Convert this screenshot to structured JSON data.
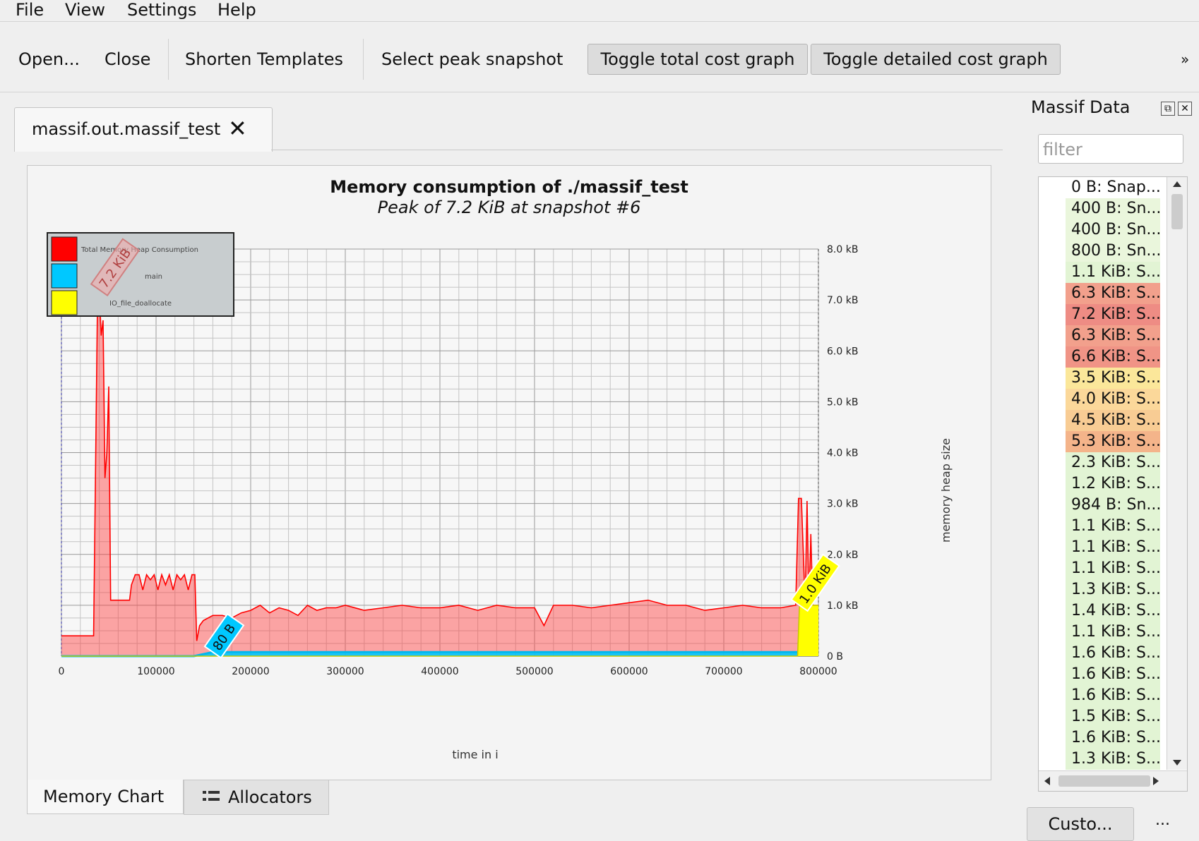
{
  "menu": {
    "file": "File",
    "view": "View",
    "settings": "Settings",
    "help": "Help"
  },
  "toolbar": {
    "open": "Open...",
    "close": "Close",
    "shorten": "Shorten Templates",
    "select_peak": "Select peak snapshot",
    "toggle_total": "Toggle total cost graph",
    "toggle_detailed": "Toggle detailed cost graph",
    "overflow": "»"
  },
  "tab": {
    "label": "massif.out.massif_test",
    "close": "✕"
  },
  "chart_data": {
    "type": "area",
    "title": "Memory consumption of ./massif_test",
    "subtitle": "Peak of 7.2 KiB at snapshot #6",
    "xlabel": "time in i",
    "ylabel": "memory heap size",
    "xlim": [
      0,
      800000
    ],
    "ylim": [
      0,
      8.0
    ],
    "x_ticks": [
      "0",
      "100000",
      "200000",
      "300000",
      "400000",
      "500000",
      "600000",
      "700000",
      "800000"
    ],
    "y_ticks": [
      "0 B",
      "1.0 kB",
      "2.0 kB",
      "3.0 kB",
      "4.0 kB",
      "5.0 kB",
      "6.0 kB",
      "7.0 kB",
      "8.0 kB"
    ],
    "grid": true,
    "legend_position": "top-left",
    "legend": [
      "Total Memory Heap Consumption",
      "main",
      "IO_file_doallocate"
    ],
    "colors": {
      "total": "#ff0000",
      "main": "#00c8ff",
      "io": "#ffff00"
    },
    "annotations": [
      {
        "text": "7.2 KiB",
        "x": 40000,
        "y": 7.2
      },
      {
        "text": "80 B",
        "x": 160000,
        "y": 0.08
      },
      {
        "text": "1.0 KiB",
        "x": 780000,
        "y": 1.0
      }
    ],
    "series": [
      {
        "name": "Total Memory Heap Consumption",
        "x": [
          0,
          30000,
          34000,
          38000,
          40000,
          42000,
          44000,
          46000,
          48000,
          50000,
          52000,
          56000,
          60000,
          72000,
          74000,
          78000,
          82000,
          86000,
          90000,
          94000,
          98000,
          102000,
          106000,
          110000,
          114000,
          118000,
          122000,
          126000,
          130000,
          134000,
          138000,
          141000,
          143000,
          146000,
          150000,
          160000,
          170000,
          180000,
          190000,
          200000,
          210000,
          220000,
          230000,
          240000,
          250000,
          260000,
          270000,
          280000,
          290000,
          300000,
          320000,
          340000,
          360000,
          380000,
          400000,
          420000,
          440000,
          460000,
          480000,
          500000,
          510000,
          520000,
          540000,
          560000,
          580000,
          600000,
          620000,
          640000,
          660000,
          680000,
          700000,
          720000,
          740000,
          760000,
          776000,
          779000,
          782000,
          786000,
          788000,
          790000,
          792000,
          794000,
          796000,
          798000,
          800000
        ],
        "values": [
          0.4,
          0.4,
          0.4,
          6.8,
          7.2,
          6.3,
          6.6,
          3.5,
          4.0,
          5.3,
          1.1,
          1.1,
          1.1,
          1.1,
          1.4,
          1.6,
          1.6,
          1.3,
          1.6,
          1.5,
          1.6,
          1.3,
          1.6,
          1.4,
          1.6,
          1.3,
          1.6,
          1.5,
          1.6,
          1.3,
          1.6,
          1.6,
          0.3,
          0.6,
          0.7,
          0.8,
          0.8,
          0.75,
          0.85,
          0.9,
          1.0,
          0.85,
          0.95,
          0.9,
          0.8,
          1.0,
          0.9,
          0.95,
          0.95,
          1.0,
          0.9,
          0.95,
          1.0,
          0.95,
          0.95,
          1.0,
          0.9,
          1.0,
          0.95,
          0.95,
          0.6,
          1.0,
          1.0,
          0.95,
          1.0,
          1.05,
          1.1,
          1.0,
          1.0,
          0.9,
          0.95,
          1.0,
          0.95,
          0.95,
          1.0,
          3.1,
          3.1,
          1.0,
          3.05,
          1.0,
          2.4,
          1.0,
          1.0,
          1.0,
          1.0
        ]
      },
      {
        "name": "main",
        "x": [
          0,
          140000,
          160000,
          776000,
          800000
        ],
        "values": [
          0.0,
          0.0,
          0.08,
          0.08,
          0.08
        ]
      },
      {
        "name": "IO_file_doallocate",
        "x": [
          0,
          778000,
          780000,
          796000,
          800000
        ],
        "values": [
          0,
          0,
          1.0,
          1.0,
          1.0
        ]
      }
    ]
  },
  "bottom_tabs": {
    "memory_chart": "Memory Chart",
    "allocators": "Allocators"
  },
  "dock": {
    "title": "Massif Data",
    "filter_placeholder": "filter",
    "custom_button": "Custo...",
    "more": "...",
    "snapshots": [
      {
        "label": "0 B: Snap...",
        "color": "#ffffff"
      },
      {
        "label": "400 B: Sn...",
        "color": "#eaf6dc"
      },
      {
        "label": "400 B: Sn...",
        "color": "#eaf6dc"
      },
      {
        "label": "800 B: Sn...",
        "color": "#eaf6dc"
      },
      {
        "label": "1.1 KiB: S...",
        "color": "#e2f4d4"
      },
      {
        "label": "6.3 KiB: S...",
        "color": "#f2a08c"
      },
      {
        "label": "7.2 KiB: S...",
        "color": "#ee8c84"
      },
      {
        "label": "6.3 KiB: S...",
        "color": "#f2a08c"
      },
      {
        "label": "6.6 KiB: S...",
        "color": "#f09486"
      },
      {
        "label": "3.5 KiB: S...",
        "color": "#fbe79a"
      },
      {
        "label": "4.0 KiB: S...",
        "color": "#fbd89a"
      },
      {
        "label": "4.5 KiB: S...",
        "color": "#f8cc94"
      },
      {
        "label": "5.3 KiB: S...",
        "color": "#f4b48a"
      },
      {
        "label": "2.3 KiB: S...",
        "color": "#e2f4d4"
      },
      {
        "label": "1.2 KiB: S...",
        "color": "#e2f4d4"
      },
      {
        "label": "984 B: Sn...",
        "color": "#e2f4d4"
      },
      {
        "label": "1.1 KiB: S...",
        "color": "#e2f4d4"
      },
      {
        "label": "1.1 KiB: S...",
        "color": "#e2f4d4"
      },
      {
        "label": "1.1 KiB: S...",
        "color": "#e2f4d4"
      },
      {
        "label": "1.3 KiB: S...",
        "color": "#e2f4d4"
      },
      {
        "label": "1.4 KiB: S...",
        "color": "#e2f4d4"
      },
      {
        "label": "1.1 KiB: S...",
        "color": "#e2f4d4"
      },
      {
        "label": "1.6 KiB: S...",
        "color": "#e2f4d4"
      },
      {
        "label": "1.6 KiB: S...",
        "color": "#e2f4d4"
      },
      {
        "label": "1.6 KiB: S...",
        "color": "#e2f4d4"
      },
      {
        "label": "1.5 KiB: S...",
        "color": "#e2f4d4"
      },
      {
        "label": "1.6 KiB: S...",
        "color": "#e2f4d4"
      },
      {
        "label": "1.3 KiB: S...",
        "color": "#e2f4d4"
      }
    ]
  }
}
